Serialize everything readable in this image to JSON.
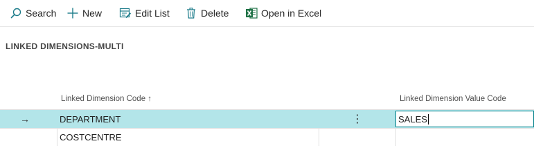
{
  "toolbar": {
    "search_label": "Search",
    "new_label": "New",
    "edit_list_label": "Edit List",
    "delete_label": "Delete",
    "open_excel_label": "Open in Excel"
  },
  "page": {
    "title": "LINKED DIMENSIONS-MULTI"
  },
  "table": {
    "columns": {
      "code_header": "Linked Dimension Code ↑",
      "value_header": "Linked Dimension Value Code"
    },
    "rows": [
      {
        "code": "DEPARTMENT",
        "value": "SALES",
        "selected": true
      },
      {
        "code": "COSTCENTRE",
        "value": "",
        "selected": false
      }
    ],
    "row_arrow": "→",
    "row_menu": "⋮"
  },
  "colors": {
    "accent": "#00808a",
    "selected_row": "#b3e5e9",
    "excel_green": "#1e7145"
  },
  "icons": {
    "search": "search-icon",
    "new": "plus-icon",
    "edit_list": "edit-list-icon",
    "delete": "trash-icon",
    "excel": "excel-icon"
  }
}
